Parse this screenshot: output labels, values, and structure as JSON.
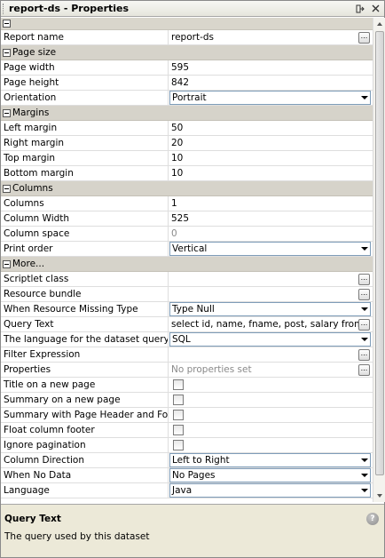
{
  "window": {
    "title": "report-ds - Properties",
    "pin_icon": "pin-icon",
    "close_icon": "close-icon"
  },
  "categories": {
    "page_size": "Page size",
    "margins": "Margins",
    "columns": "Columns",
    "more": "More..."
  },
  "props": {
    "report_name": {
      "label": "Report name",
      "value": "report-ds"
    },
    "page_width": {
      "label": "Page width",
      "value": "595"
    },
    "page_height": {
      "label": "Page height",
      "value": "842"
    },
    "orientation": {
      "label": "Orientation",
      "value": "Portrait"
    },
    "left_margin": {
      "label": "Left margin",
      "value": "50"
    },
    "right_margin": {
      "label": "Right margin",
      "value": "20"
    },
    "top_margin": {
      "label": "Top margin",
      "value": "10"
    },
    "bottom_margin": {
      "label": "Bottom margin",
      "value": "10"
    },
    "columns": {
      "label": "Columns",
      "value": "1"
    },
    "column_width": {
      "label": "Column Width",
      "value": "525"
    },
    "column_space": {
      "label": "Column space",
      "value": "0"
    },
    "print_order": {
      "label": "Print order",
      "value": "Vertical"
    },
    "scriptlet_class": {
      "label": "Scriptlet class",
      "value": ""
    },
    "resource_bundle": {
      "label": "Resource bundle",
      "value": ""
    },
    "when_resource_missing": {
      "label": "When Resource Missing Type",
      "value": "Type Null"
    },
    "query_text": {
      "label": "Query Text",
      "value": "select id, name, fname, post, salary from e..."
    },
    "query_language": {
      "label": "The language for the dataset query",
      "value": "SQL"
    },
    "filter_expression": {
      "label": "Filter Expression",
      "value": ""
    },
    "properties": {
      "label": "Properties",
      "value": "No properties set"
    },
    "title_new_page": {
      "label": "Title on a new page"
    },
    "summary_new_page": {
      "label": "Summary on a new page"
    },
    "summary_header_footer": {
      "label": "Summary with Page Header and Footer"
    },
    "float_column_footer": {
      "label": "Float column footer"
    },
    "ignore_pagination": {
      "label": "Ignore pagination"
    },
    "column_direction": {
      "label": "Column Direction",
      "value": "Left to Right"
    },
    "when_no_data": {
      "label": "When No Data",
      "value": "No Pages"
    },
    "language": {
      "label": "Language",
      "value": "Java"
    }
  },
  "ellipsis": "...",
  "description": {
    "title": "Query Text",
    "text": "The query used by this dataset",
    "help_icon": "help-icon"
  }
}
